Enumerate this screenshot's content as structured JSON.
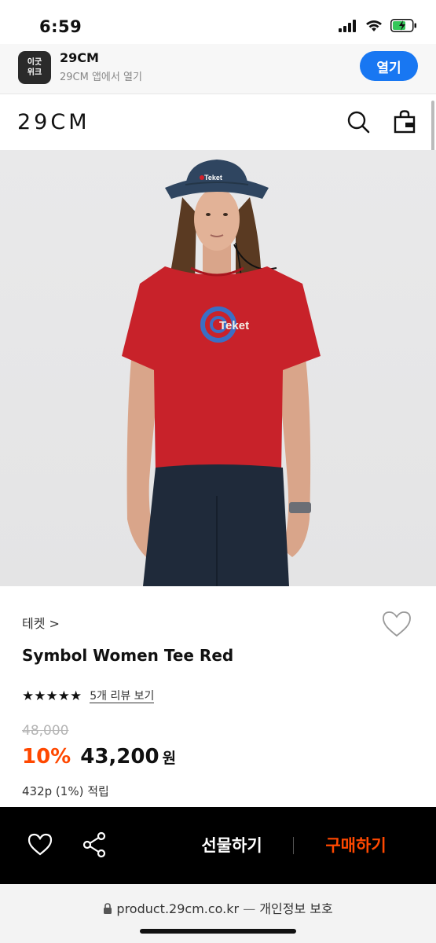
{
  "status": {
    "time": "6:59"
  },
  "app_banner": {
    "icon_line1": "이굿",
    "icon_line2": "위크",
    "name": "29CM",
    "subtitle": "29CM 앱에서 열기",
    "open_label": "열기"
  },
  "header": {
    "logo": "29CM",
    "icons": [
      "search-icon",
      "shopping-bag-icon"
    ]
  },
  "hero": {
    "cap_text": "Teket",
    "shirt_text": "Teket"
  },
  "product": {
    "brand": "테켓 >",
    "name": "Symbol Women Tee Red",
    "stars": "★★★★★",
    "review_link": "5개 리뷰 보기",
    "original_price": "48,000",
    "discount": "10%",
    "price": "43,200",
    "currency": "원",
    "points": "432p (1%) 적립"
  },
  "bottom_bar": {
    "gift_label": "선물하기",
    "buy_label": "구매하기",
    "icons": [
      "heart-icon",
      "share-icon"
    ]
  },
  "browser": {
    "url": "product.29cm.co.kr",
    "separator": "—",
    "privacy": "개인정보 보호"
  },
  "colors": {
    "accent": "#ff4800",
    "open_button": "#1877f2",
    "shirt": "#c8222a"
  }
}
